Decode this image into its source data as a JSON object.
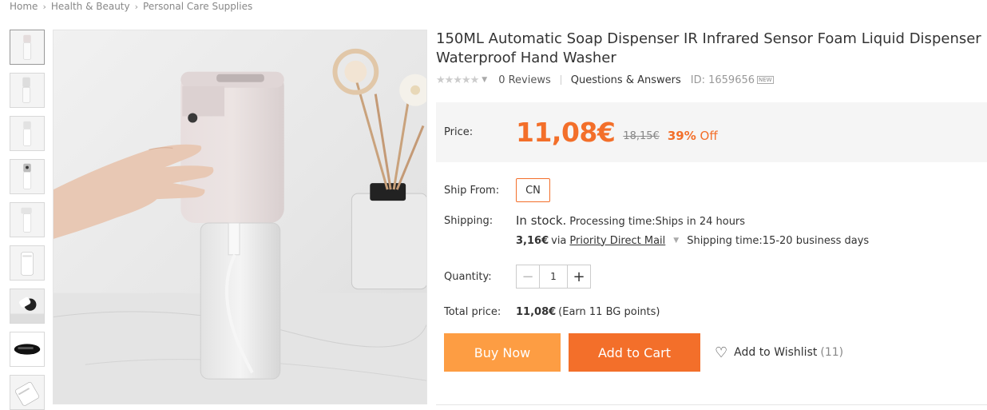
{
  "breadcrumb": [
    "Home",
    "Health & Beauty",
    "Personal Care Supplies"
  ],
  "product": {
    "title": "150ML Automatic Soap Dispenser IR Infrared Sensor Foam Liquid Dispenser Waterproof Hand Washer",
    "reviews": "0 Reviews",
    "qa": "Questions & Answers",
    "id": "ID: 1659656",
    "new_badge": "NEW",
    "rating": 0
  },
  "price": {
    "label": "Price:",
    "current": "11,08€",
    "original": "18,15€",
    "off_pct": "39%",
    "off_text": "Off"
  },
  "ship_from": {
    "label": "Ship From:",
    "value": "CN"
  },
  "shipping": {
    "label": "Shipping:",
    "stock": "In stock.",
    "processing": "Processing time:Ships in 24 hours",
    "cost": "3,16€",
    "via": "via",
    "method": "Priority Direct Mail",
    "time": "Shipping time:15-20 business days"
  },
  "quantity": {
    "label": "Quantity:",
    "value": "1"
  },
  "total": {
    "label": "Total price:",
    "value": "11,08€",
    "points": "(Earn 11 BG points)"
  },
  "actions": {
    "buy_now": "Buy Now",
    "add_cart": "Add to Cart",
    "wishlist": "Add to Wishlist",
    "wishlist_count": "(11)"
  },
  "colors": {
    "accent": "#f36f2a",
    "buy_now": "#fd9d43"
  }
}
